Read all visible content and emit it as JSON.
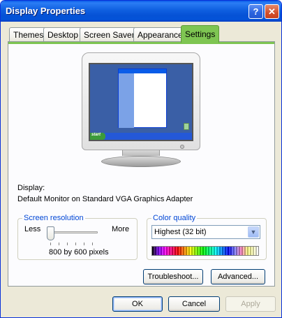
{
  "window": {
    "title": "Display Properties"
  },
  "titlebar": {
    "help_label": "?",
    "close_label": "✕"
  },
  "tabs": [
    {
      "label": "Themes"
    },
    {
      "label": "Desktop"
    },
    {
      "label": "Screen Saver"
    },
    {
      "label": "Appearance"
    },
    {
      "label": "Settings"
    }
  ],
  "active_tab": "Settings",
  "preview": {
    "start_label": "start"
  },
  "display": {
    "label": "Display:",
    "device": "Default Monitor on Standard VGA Graphics Adapter"
  },
  "resolution": {
    "group_title": "Screen resolution",
    "less_label": "Less",
    "more_label": "More",
    "value_text": "800 by 600 pixels",
    "slider_position": 0
  },
  "color_quality": {
    "group_title": "Color quality",
    "selected": "Highest (32 bit)"
  },
  "buttons": {
    "troubleshoot": "Troubleshoot...",
    "advanced": "Advanced...",
    "ok": "OK",
    "cancel": "Cancel",
    "apply": "Apply"
  },
  "colors": {
    "title_bar": "#0a5ce8",
    "active_tab": "#7ec552",
    "group_title": "#0046d5",
    "dialog_bg": "#ece9d8"
  }
}
